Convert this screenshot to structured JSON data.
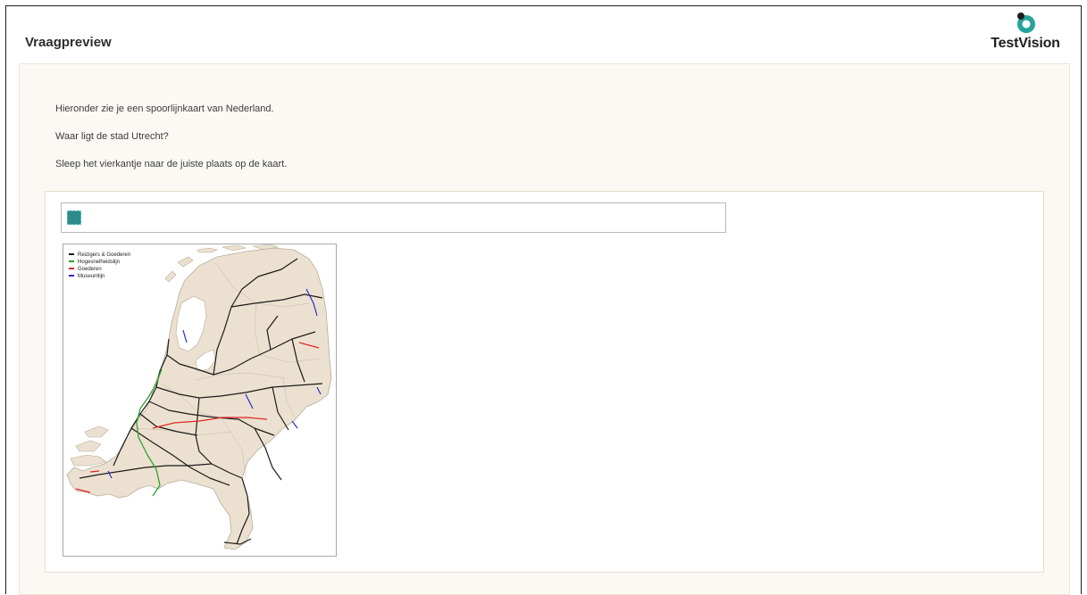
{
  "header": {
    "title": "Vraagpreview",
    "logo_text": "TestVision"
  },
  "question": {
    "line1": "Hieronder zie je een spoorlijnkaart van Nederland.",
    "line2": "Waar ligt de stad Utrecht?",
    "line3": "Sleep het vierkantje naar de juiste plaats op de kaart."
  },
  "map": {
    "legend": [
      {
        "label": "Reizigers & Goederen",
        "color": "#1b1b1b"
      },
      {
        "label": "Hogesnelheidslijn",
        "color": "#2fa52f"
      },
      {
        "label": "Goederen",
        "color": "#e02828"
      },
      {
        "label": "Museumlijn",
        "color": "#2a2ad4"
      }
    ]
  },
  "colors": {
    "accent": "#2d8b8b",
    "panel_bg": "#fcf9f4",
    "land": "#ece1d0"
  }
}
